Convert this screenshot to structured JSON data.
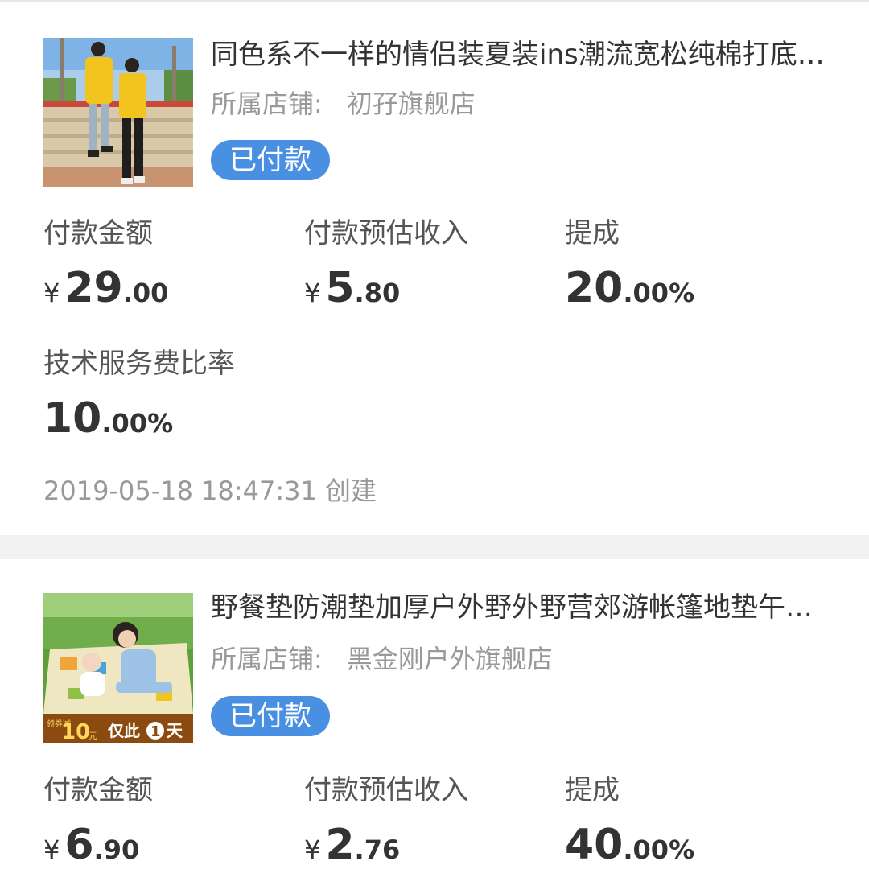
{
  "orders": [
    {
      "title": "同色系不一样的情侣装夏装ins潮流宽松纯棉打底…",
      "shop_label": "所属店铺:",
      "shop_name": "初孖旗舰店",
      "status": "已付款",
      "pay_amount": {
        "label": "付款金额",
        "currency": "¥",
        "int": "29",
        "dec": ".00"
      },
      "est_income": {
        "label": "付款预估收入",
        "currency": "¥",
        "int": "5",
        "dec": ".80"
      },
      "commission": {
        "label": "提成",
        "int": "20",
        "dec": ".00%"
      },
      "service_fee": {
        "label": "技术服务费比率",
        "int": "10",
        "dec": ".00%"
      },
      "created": "2019-05-18 18:47:31 创建"
    },
    {
      "title": "野餐垫防潮垫加厚户外野外野营郊游帐篷地垫午…",
      "shop_label": "所属店铺:",
      "shop_name": "黑金刚户外旗舰店",
      "status": "已付款",
      "pay_amount": {
        "label": "付款金额",
        "currency": "¥",
        "int": "6",
        "dec": ".90"
      },
      "est_income": {
        "label": "付款预估收入",
        "currency": "¥",
        "int": "2",
        "dec": ".76"
      },
      "commission": {
        "label": "提成",
        "int": "40",
        "dec": ".00%"
      },
      "promo": {
        "prefix": "领券减",
        "amount": "10",
        "unit": "元",
        "text1": "仅此",
        "num": "1",
        "text2": "天"
      }
    }
  ],
  "colors": {
    "accent": "#4a90e2",
    "muted": "#999999",
    "text": "#333333",
    "separator": "#f2f2f2"
  }
}
